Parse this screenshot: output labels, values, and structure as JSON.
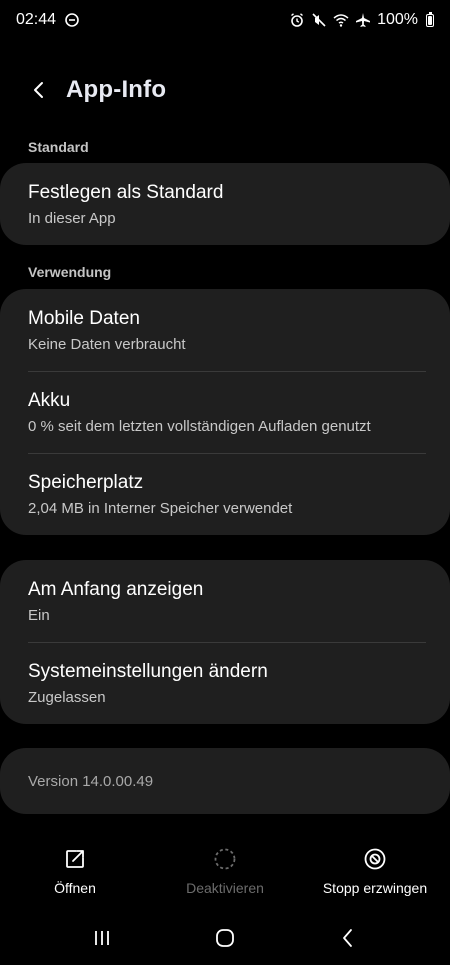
{
  "status": {
    "time": "02:44",
    "battery_text": "100%",
    "icons": [
      "dnd-icon",
      "alarm-icon",
      "mute-icon",
      "wifi-icon",
      "airplane-icon",
      "battery-icon"
    ]
  },
  "header": {
    "title": "App-Info"
  },
  "sections": {
    "standard_label": "Standard",
    "usage_label": "Verwendung"
  },
  "cards": {
    "default": {
      "title": "Festlegen als Standard",
      "subtitle": "In dieser App"
    },
    "usage": [
      {
        "title": "Mobile Daten",
        "subtitle": "Keine Daten verbraucht"
      },
      {
        "title": "Akku",
        "subtitle": "0 % seit dem letzten vollständigen Aufladen genutzt"
      },
      {
        "title": "Speicherplatz",
        "subtitle": "2,04 MB in Interner Speicher verwendet"
      }
    ],
    "more": [
      {
        "title": "Am Anfang anzeigen",
        "subtitle": "Ein"
      },
      {
        "title": "Systemeinstellungen ändern",
        "subtitle": "Zugelassen"
      }
    ],
    "version": "Version 14.0.00.49"
  },
  "actions": {
    "open_label": "Öffnen",
    "deactivate_label": "Deaktivieren",
    "force_stop_label": "Stopp erzwingen"
  },
  "colors": {
    "background": "#000000",
    "card": "#1f1f1f",
    "disabled_text": "#6c6c6c"
  }
}
